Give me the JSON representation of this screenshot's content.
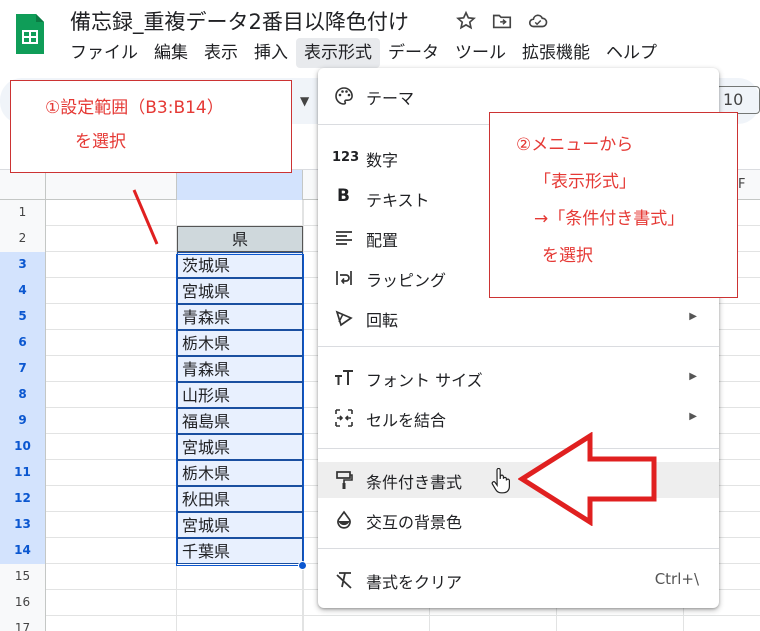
{
  "header": {
    "doc_title": "備忘録_重複データ2番目以降色付け",
    "menu": [
      "ファイル",
      "編集",
      "表示",
      "挿入",
      "表示形式",
      "データ",
      "ツール",
      "拡張機能",
      "ヘルプ"
    ],
    "active_menu_index": 4
  },
  "toolbar": {
    "zoom_value": "10"
  },
  "grid": {
    "columns": [
      {
        "label": "",
        "selected": true
      },
      {
        "label": "F",
        "selected": false
      }
    ],
    "rows": [
      {
        "num": "1",
        "b": "",
        "selected": false
      },
      {
        "num": "2",
        "b": "県",
        "selected": false,
        "header": true
      },
      {
        "num": "3",
        "b": "茨城県",
        "selected": true
      },
      {
        "num": "4",
        "b": "宮城県",
        "selected": true
      },
      {
        "num": "5",
        "b": "青森県",
        "selected": true
      },
      {
        "num": "6",
        "b": "栃木県",
        "selected": true
      },
      {
        "num": "7",
        "b": "青森県",
        "selected": true
      },
      {
        "num": "8",
        "b": "山形県",
        "selected": true
      },
      {
        "num": "9",
        "b": "福島県",
        "selected": true
      },
      {
        "num": "10",
        "b": "宮城県",
        "selected": true
      },
      {
        "num": "11",
        "b": "栃木県",
        "selected": true
      },
      {
        "num": "12",
        "b": "秋田県",
        "selected": true
      },
      {
        "num": "13",
        "b": "宮城県",
        "selected": true
      },
      {
        "num": "14",
        "b": "千葉県",
        "selected": true
      },
      {
        "num": "15",
        "b": "",
        "selected": false
      },
      {
        "num": "16",
        "b": "",
        "selected": false
      },
      {
        "num": "17",
        "b": "",
        "selected": false
      }
    ]
  },
  "callout1": {
    "line1": "①設定範囲（B3:B14）",
    "line2": "を選択"
  },
  "callout2": {
    "line1": "②メニューから",
    "line2": "「表示形式」",
    "line3": "→「条件付き書式」",
    "line4": "を選択"
  },
  "dropdown": {
    "items": [
      {
        "label": "テーマ",
        "icon": "palette-icon"
      },
      {
        "label": "数字",
        "icon": "number-format-icon"
      },
      {
        "label": "テキスト",
        "icon": "bold-icon"
      },
      {
        "label": "配置",
        "icon": "align-icon"
      },
      {
        "label": "ラッピング",
        "icon": "wrap-icon"
      },
      {
        "label": "回転",
        "icon": "rotate-icon",
        "submenu": true
      },
      {
        "label": "フォント サイズ",
        "icon": "font-size-icon",
        "submenu": true
      },
      {
        "label": "セルを結合",
        "icon": "merge-icon",
        "submenu": true
      },
      {
        "label": "条件付き書式",
        "icon": "paint-roller-icon"
      },
      {
        "label": "交互の背景色",
        "icon": "fill-drop-icon"
      },
      {
        "label": "書式をクリア",
        "icon": "clear-format-icon",
        "shortcut": "Ctrl+\\"
      }
    ],
    "number_icon_text": "123",
    "text_icon_glyph": "B"
  },
  "colors": {
    "accent": "#0b57d0",
    "callout_red": "#e53935",
    "sheets_green": "#0f9d58"
  }
}
